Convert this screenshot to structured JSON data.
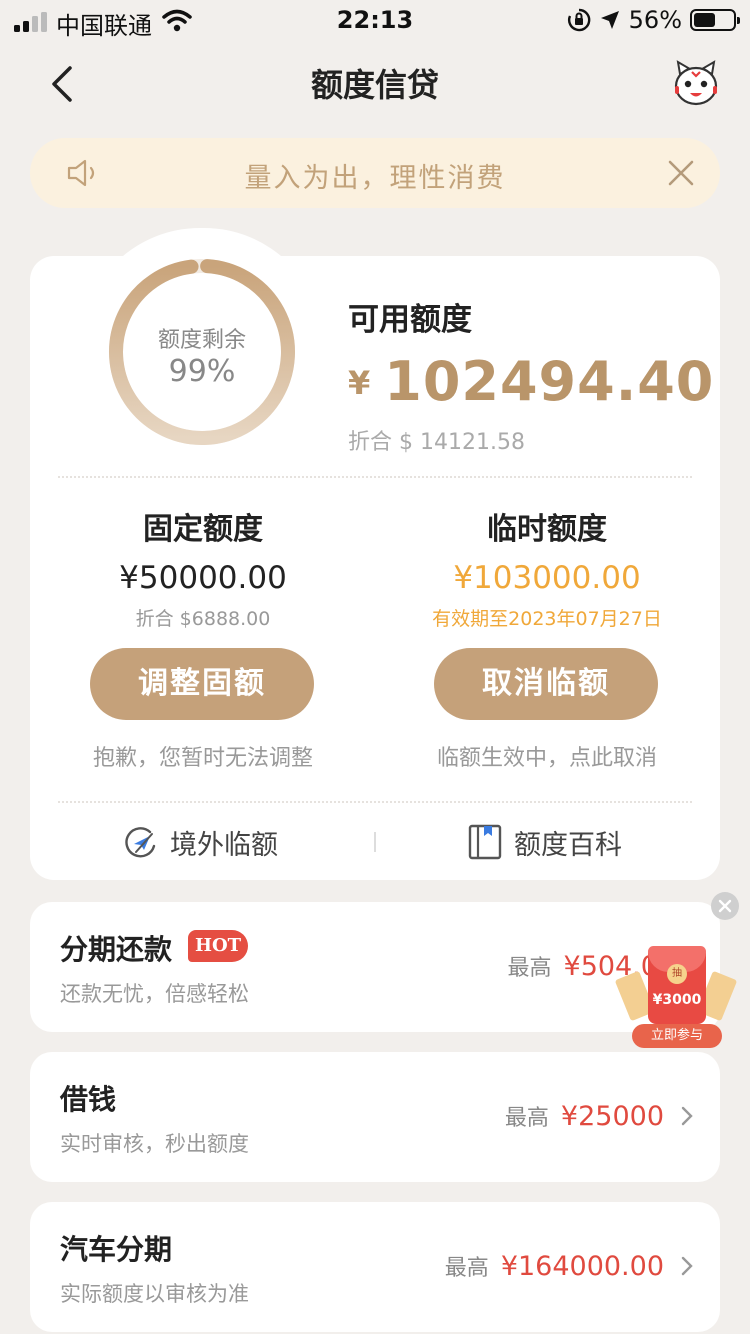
{
  "status_bar": {
    "carrier": "中国联通",
    "time": "22:13",
    "battery_pct": "56%",
    "battery_level": 0.56
  },
  "nav": {
    "title": "额度信贷",
    "back_icon": "chevron-left-icon",
    "mascot_icon": "mascot-icon"
  },
  "notice": {
    "text": "量入为出，理性消费",
    "icon": "speaker-icon",
    "close_icon": "close-icon"
  },
  "summary": {
    "ring_label": "额度剩余",
    "ring_pct": "99%",
    "ring_fraction": 0.99,
    "available_label": "可用额度",
    "available_currency": "¥",
    "available_amount": "102494.40",
    "available_usd": "折合 $ 14121.58"
  },
  "fixed": {
    "title": "固定额度",
    "amount": "¥50000.00",
    "sub": "折合 $6888.00",
    "button": "调整固额",
    "note": "抱歉，您暂时无法调整"
  },
  "temp": {
    "title": "临时额度",
    "amount": "¥103000.00",
    "sub": "有效期至2023年07月27日",
    "button": "取消临额",
    "note": "临额生效中，点此取消"
  },
  "links": {
    "overseas": "境外临额",
    "wiki": "额度百科"
  },
  "services": [
    {
      "title": "分期还款",
      "badge": "HOT",
      "sub": "还款无忧，倍感轻松",
      "max_label": "最高",
      "max_value": "¥504.0"
    },
    {
      "title": "借钱",
      "sub": "实时审核，秒出额度",
      "max_label": "最高",
      "max_value": "¥25000"
    },
    {
      "title": "汽车分期",
      "sub": "实际额度以审核为准",
      "max_label": "最高",
      "max_value": "¥164000.00"
    }
  ],
  "promo": {
    "coin_text": "抽",
    "amount": "¥3000",
    "button": "立即参与"
  },
  "colors": {
    "gold": "#b9956a",
    "button_gold": "#c5a17a",
    "temp_orange": "#f0a83a",
    "red": "#e04a3f",
    "notice_bg": "#fbf1df",
    "page_bg": "#f2efec"
  }
}
